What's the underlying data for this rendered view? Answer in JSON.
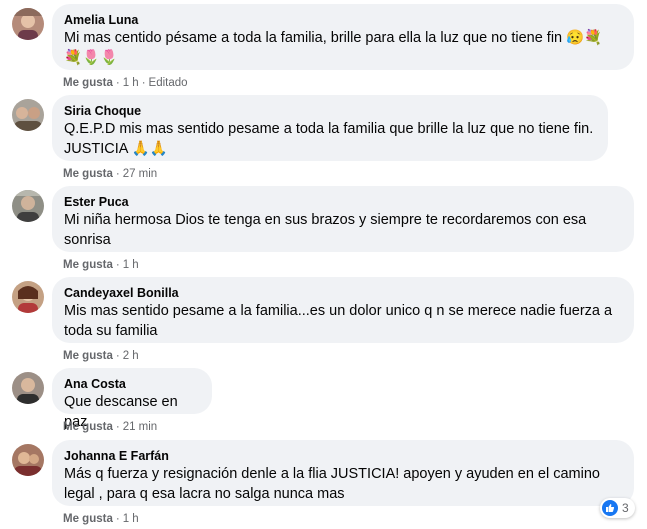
{
  "comments": [
    {
      "name": "Amelia Luna",
      "text": "Mi mas centido pésame a toda la familia, brille para ella la luz que no tiene fin 😥💐 💐🌷🌷",
      "like_label": "Me gusta",
      "time": "1 h",
      "edited": "Editado"
    },
    {
      "name": "Siria Choque",
      "text": "Q.E.P.D mis mas sentido pesame a toda la familia que brille la luz que no tiene fin. JUSTICIA 🙏🙏",
      "like_label": "Me gusta",
      "time": "27 min"
    },
    {
      "name": "Ester Puca",
      "text": "Mi niña hermosa Dios te tenga en sus brazos y siempre te recordaremos con esa sonrisa",
      "like_label": "Me gusta",
      "time": "1 h"
    },
    {
      "name": "Candeyaxel Bonilla",
      "text": "Mis mas sentido pesame a la familia...es un dolor unico q n se merece nadie fuerza a toda su familia",
      "like_label": "Me gusta",
      "time": "2 h"
    },
    {
      "name": "Ana Costa",
      "text": "Que descanse en paz",
      "like_label": "Me gusta",
      "time": "21 min"
    },
    {
      "name": "Johanna E Farfán",
      "text": "Más q fuerza y resignación denle a la flia JUSTICIA! apoyen y ayuden en el camino legal , para q esa lacra no salga nunca mas",
      "like_label": "Me gusta",
      "time": "1 h",
      "reactions": {
        "icon": "like-icon",
        "count": "3"
      }
    }
  ],
  "colors": {
    "bubble": "#f0f2f5",
    "meta": "#65676b",
    "like_blue": "#1877f2"
  }
}
